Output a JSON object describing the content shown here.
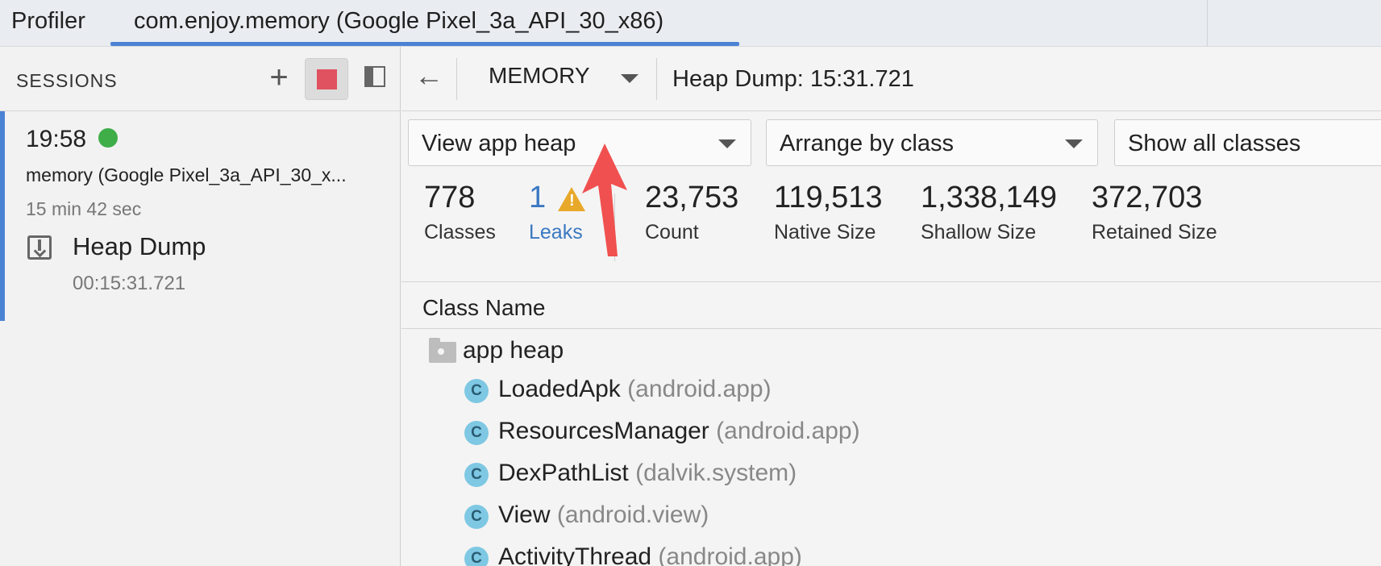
{
  "tabs": {
    "profiler": "Profiler",
    "session": "com.enjoy.memory (Google Pixel_3a_API_30_x86)"
  },
  "sessions": {
    "title": "SESSIONS",
    "add_label": "+",
    "session": {
      "time": "19:58",
      "device": "memory (Google Pixel_3a_API_30_x...",
      "duration": "15 min 42 sec",
      "heap_dump_label": "Heap Dump",
      "heap_dump_time": "00:15:31.721"
    }
  },
  "toolbar": {
    "back_label": "←",
    "profiler_select": "MEMORY",
    "title": "Heap Dump: 15:31.721"
  },
  "filters": {
    "heap": "View app heap",
    "arrange": "Arrange by class",
    "show": "Show all classes"
  },
  "stats": [
    {
      "value": "778",
      "label": "Classes"
    },
    {
      "value": "1",
      "label": "Leaks"
    },
    {
      "value": "23,753",
      "label": "Count"
    },
    {
      "value": "119,513",
      "label": "Native Size"
    },
    {
      "value": "1,338,149",
      "label": "Shallow Size"
    },
    {
      "value": "372,703",
      "label": "Retained Size"
    }
  ],
  "table": {
    "column_class_name": "Class Name",
    "group": "app heap",
    "class_icon_letter": "C",
    "rows": [
      {
        "name": "LoadedApk",
        "package": "(android.app)"
      },
      {
        "name": "ResourcesManager",
        "package": "(android.app)"
      },
      {
        "name": "DexPathList",
        "package": "(dalvik.system)"
      },
      {
        "name": "View",
        "package": "(android.view)"
      },
      {
        "name": "ActivityThread",
        "package": "(android.app)"
      }
    ]
  },
  "colors": {
    "accent": "#4a83d4",
    "live": "#3fae49",
    "stop": "#e05260",
    "leak": "#3a78c2",
    "warning": "#e8a82a",
    "annotation_arrow": "#f0504f"
  }
}
